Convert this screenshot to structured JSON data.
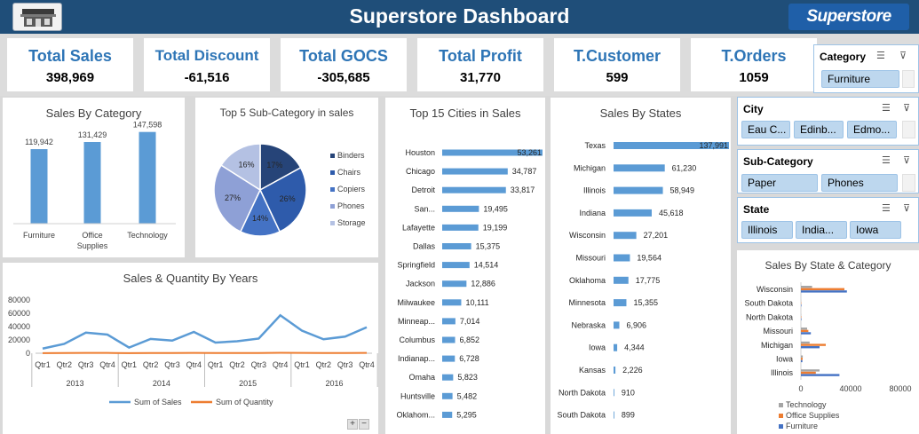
{
  "header": {
    "title": "Superstore Dashboard",
    "brand": "Superstore"
  },
  "kpis": [
    {
      "label": "Total Sales",
      "value": "398,969"
    },
    {
      "label": "Total Discount",
      "value": "-61,516"
    },
    {
      "label": "Total GOCS",
      "value": "-305,685"
    },
    {
      "label": "Total Profit",
      "value": "31,770"
    },
    {
      "label": "T.Customer",
      "value": "599"
    },
    {
      "label": "T.Orders",
      "value": "1059"
    }
  ],
  "slicers": {
    "category": {
      "title": "Category",
      "items": [
        "Furniture"
      ]
    },
    "city": {
      "title": "City",
      "items": [
        "Eau C...",
        "Edinb...",
        "Edmo..."
      ]
    },
    "subcategory": {
      "title": "Sub-Category",
      "items": [
        "Paper",
        "Phones"
      ]
    },
    "state": {
      "title": "State",
      "items": [
        "Illinois",
        "India...",
        "Iowa"
      ]
    }
  },
  "zoom": {
    "plus": "+",
    "minus": "−"
  },
  "chart_data": [
    {
      "id": "sales_by_category",
      "type": "bar",
      "title": "Sales By Category",
      "categories": [
        "Furniture",
        "Office Supplies",
        "Technology"
      ],
      "category_lines": [
        [
          "Furniture"
        ],
        [
          "Office",
          "Supplies"
        ],
        [
          "Technology"
        ]
      ],
      "values": [
        119942,
        131429,
        147598
      ],
      "value_labels": [
        "119,942",
        "131,429",
        "147,598"
      ],
      "color": "#5b9bd5"
    },
    {
      "id": "top5_subcategory",
      "type": "pie",
      "title": "Top 5 Sub-Category in sales",
      "labels": [
        "Binders",
        "Chairs",
        "Copiers",
        "Phones",
        "Storage"
      ],
      "values": [
        17,
        26,
        14,
        27,
        16
      ],
      "value_labels": [
        "17%",
        "26%",
        "14%",
        "27%",
        "16%"
      ],
      "colors": [
        "#264478",
        "#2e5bab",
        "#4472c4",
        "#8ea0d6",
        "#b4c1e3"
      ]
    },
    {
      "id": "top15_cities",
      "type": "bar",
      "orientation": "horizontal",
      "title": "Top 15 Cities in Sales",
      "categories": [
        "Houston",
        "Chicago",
        "Detroit",
        "San...",
        "Lafayette",
        "Dallas",
        "Springfield",
        "Jackson",
        "Milwaukee",
        "Minneap...",
        "Columbus",
        "Indianap...",
        "Omaha",
        "Huntsville",
        "Oklahom..."
      ],
      "values": [
        53261,
        34787,
        33817,
        19495,
        19199,
        15375,
        14514,
        12886,
        10111,
        7014,
        6852,
        6728,
        5823,
        5482,
        5295
      ],
      "value_labels": [
        "53,261",
        "34,787",
        "33,817",
        "19,495",
        "19,199",
        "15,375",
        "14,514",
        "12,886",
        "10,111",
        "7,014",
        "6,852",
        "6,728",
        "5,823",
        "5,482",
        "5,295"
      ],
      "color": "#5b9bd5"
    },
    {
      "id": "sales_by_states",
      "type": "bar",
      "orientation": "horizontal",
      "title": "Sales By States",
      "categories": [
        "Texas",
        "Michigan",
        "Illinois",
        "Indiana",
        "Wisconsin",
        "Missouri",
        "Oklahoma",
        "Minnesota",
        "Nebraska",
        "Iowa",
        "Kansas",
        "North Dakota",
        "South Dakota"
      ],
      "values": [
        137991,
        61230,
        58949,
        45618,
        27201,
        19564,
        17775,
        15355,
        6906,
        4344,
        2226,
        910,
        899
      ],
      "value_labels": [
        "137,991",
        "61,230",
        "58,949",
        "45,618",
        "27,201",
        "19,564",
        "17,775",
        "15,355",
        "6,906",
        "4,344",
        "2,226",
        "910",
        "899"
      ],
      "color": "#5b9bd5"
    },
    {
      "id": "sales_qty_by_years",
      "type": "line",
      "title": "Sales & Quantity By Years",
      "quarters": [
        "Qtr1",
        "Qtr2",
        "Qtr3",
        "Qtr4"
      ],
      "years": [
        "2013",
        "2014",
        "2015",
        "2016"
      ],
      "ylim": [
        0,
        80000
      ],
      "yticks": [
        0,
        20000,
        40000,
        60000,
        80000
      ],
      "series": [
        {
          "name": "Sum of Sales",
          "color": "#5b9bd5",
          "values": [
            7000,
            14000,
            31000,
            28000,
            8500,
            21500,
            19000,
            32000,
            16000,
            18000,
            22000,
            57000,
            34000,
            21000,
            25000,
            39000
          ]
        },
        {
          "name": "Sum of Quantity",
          "color": "#ed7d31",
          "values": [
            200,
            300,
            450,
            420,
            180,
            350,
            320,
            500,
            280,
            300,
            350,
            700,
            500,
            320,
            400,
            550
          ]
        }
      ]
    },
    {
      "id": "sales_by_state_category",
      "type": "bar",
      "orientation": "horizontal",
      "title": "Sales By State & Category",
      "categories": [
        "Wisconsin",
        "South Dakota",
        "North Dakota",
        "Missouri",
        "Michigan",
        "Iowa",
        "Illinois"
      ],
      "xlim": [
        0,
        80000
      ],
      "xticks": [
        "0",
        "40000",
        "80000"
      ],
      "series": [
        {
          "name": "Technology",
          "color": "#a5a5a5",
          "values": [
            9000,
            100,
            150,
            5000,
            7000,
            1500,
            15000
          ]
        },
        {
          "name": "Office Supplies",
          "color": "#ed7d31",
          "values": [
            35000,
            250,
            300,
            6000,
            20000,
            1400,
            12000
          ]
        },
        {
          "name": "Furniture",
          "color": "#4472c4",
          "values": [
            37000,
            400,
            400,
            8000,
            15000,
            1200,
            31000
          ]
        }
      ]
    }
  ]
}
